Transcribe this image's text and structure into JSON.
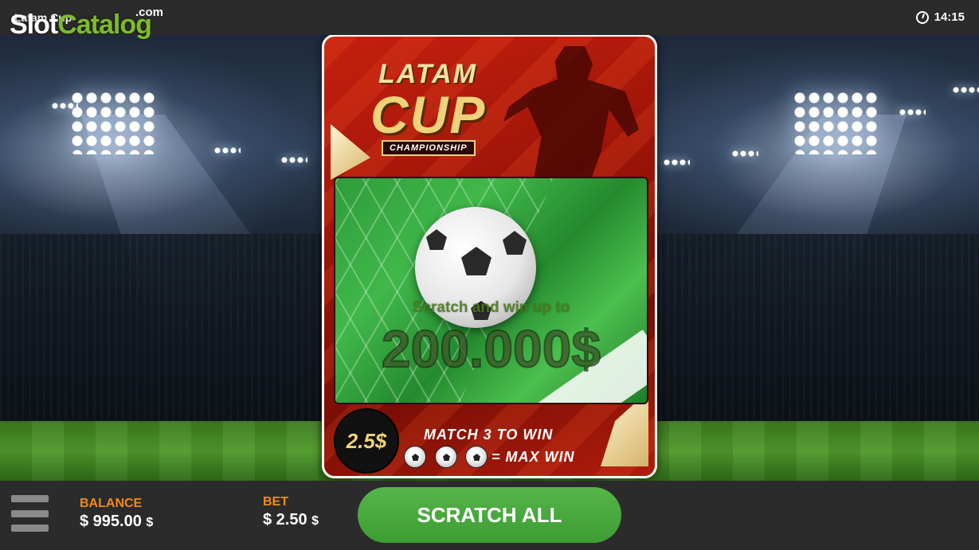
{
  "header": {
    "game_title": "Latam Cup",
    "logo_slot": "Slot",
    "logo_catalog": "Catalog",
    "logo_com": ".com",
    "clock_icon": "clock-icon",
    "time": "14:15"
  },
  "card": {
    "title_line1": "LATAM",
    "title_line2": "CUP",
    "title_badge": "CHAMPIONSHIP",
    "scratch_prompt": "Scratch and win up to",
    "max_prize": "200.000$",
    "price": "2.5$",
    "rule_line1": "MATCH 3 TO WIN",
    "rule_line2": "= MAX WIN",
    "rule_icon": "soccer-ball-icon",
    "colors": {
      "card_red": "#c4200f",
      "gold": "#f0d27a",
      "scratch_green": "#40b84a"
    }
  },
  "footer": {
    "menu_icon": "hamburger-menu-icon",
    "balance_label": "BALANCE",
    "balance_value": "$ 995.00",
    "balance_unit": "$",
    "bet_label": "BET",
    "bet_value": "$ 2.50",
    "bet_unit": "$",
    "scratch_all_label": "SCRATCH ALL",
    "colors": {
      "label_orange": "#f08a1c",
      "button_green": "#4cae41",
      "bar_bg": "#2b2b2b"
    }
  }
}
